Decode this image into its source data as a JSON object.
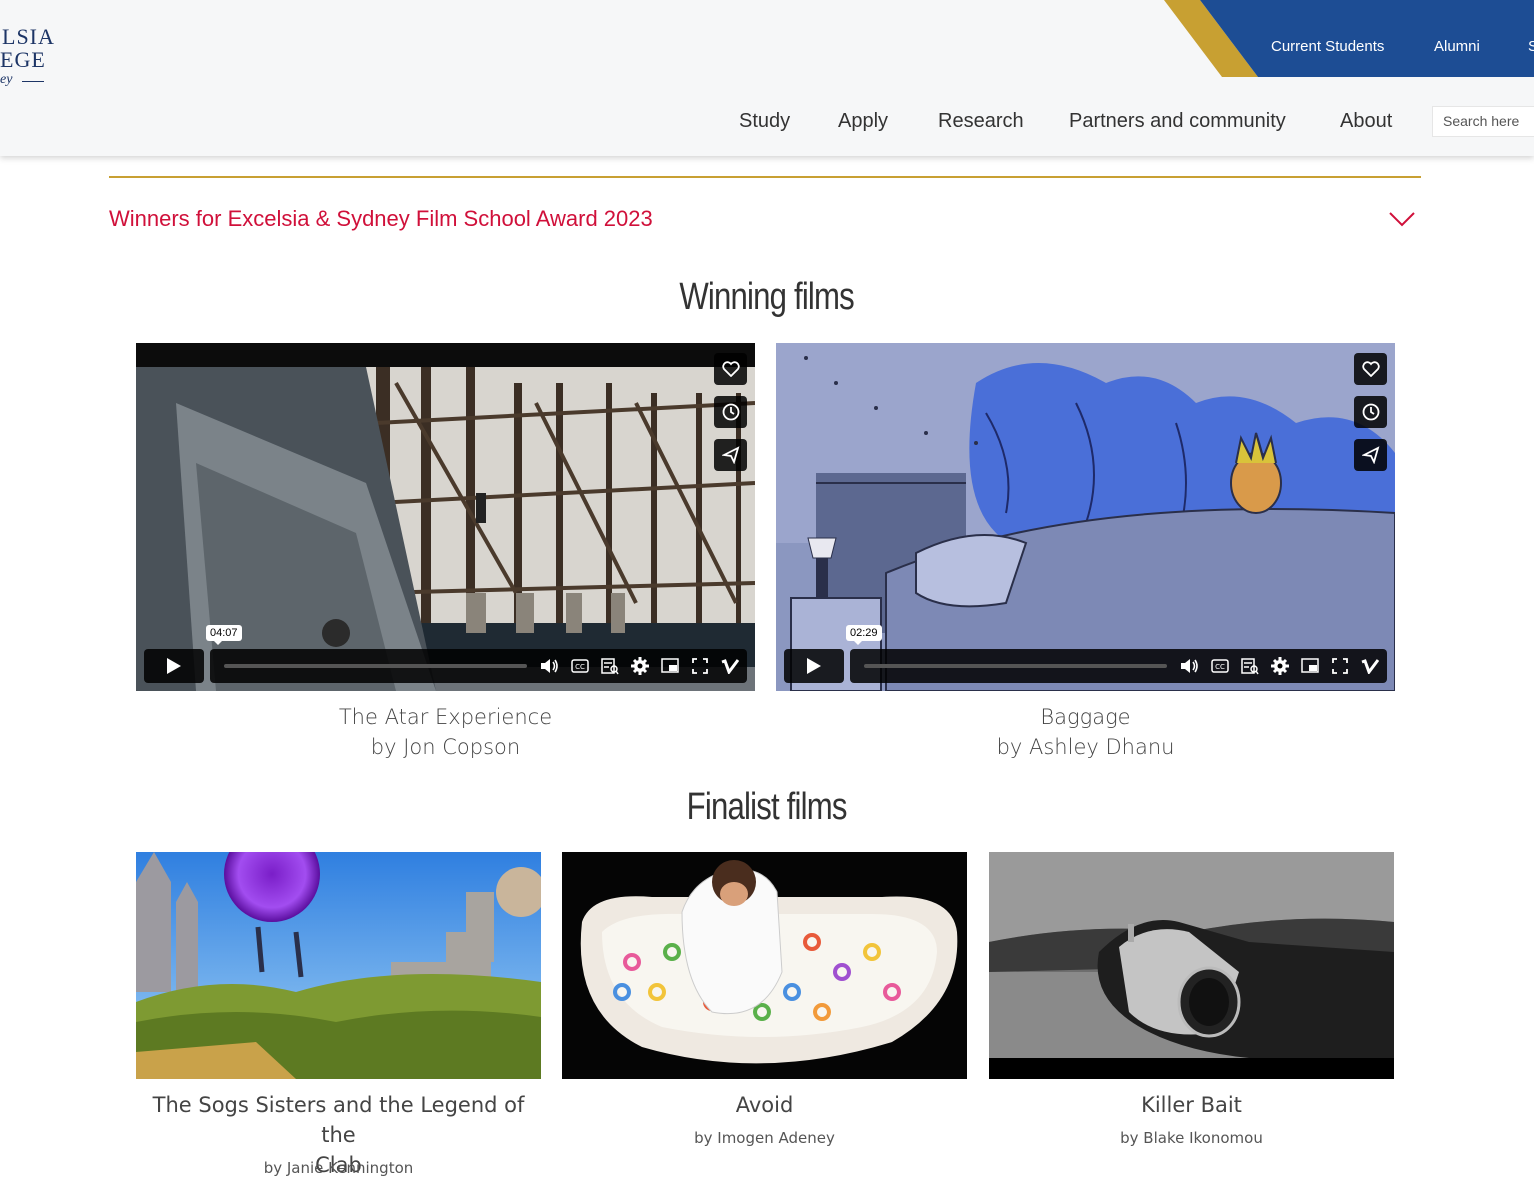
{
  "logo": {
    "line1": "LSIA",
    "line2": "EGE",
    "line3": "ey"
  },
  "topnav": {
    "current_students": "Current Students",
    "alumni": "Alumni",
    "third": "S"
  },
  "mainnav": {
    "study": "Study",
    "apply": "Apply",
    "research": "Research",
    "partners": "Partners and community",
    "about": "About"
  },
  "search": {
    "placeholder": "Search here"
  },
  "accordion": {
    "title": "Winners for Excelsia & Sydney Film School Award 2023"
  },
  "winning": {
    "heading": "Winning films",
    "films": [
      {
        "title": "The Atar Experience",
        "by": "by Jon Copson",
        "duration": "04:07"
      },
      {
        "title": "Baggage",
        "by": "by Ashley Dhanu",
        "duration": "02:29"
      }
    ]
  },
  "finalist": {
    "heading": "Finalist films",
    "films": [
      {
        "title_line1": "The Sogs Sisters and the Legend of the",
        "title_line2": "Clab",
        "by": "by Janie Kennington"
      },
      {
        "title_line1": "Avoid",
        "by": "by Imogen Adeney"
      },
      {
        "title_line1": "Killer Bait",
        "by": "by Blake Ikonomou"
      }
    ]
  },
  "colors": {
    "navy": "#1d4d94",
    "gold": "#c8a032",
    "accent_red": "#d0103a"
  },
  "icons": [
    "heart-icon",
    "clock-icon",
    "send-icon",
    "play-icon",
    "volume-icon",
    "cc-icon",
    "transcript-icon",
    "settings-icon",
    "pip-icon",
    "fullscreen-icon",
    "vimeo-icon",
    "chevron-down-icon"
  ]
}
